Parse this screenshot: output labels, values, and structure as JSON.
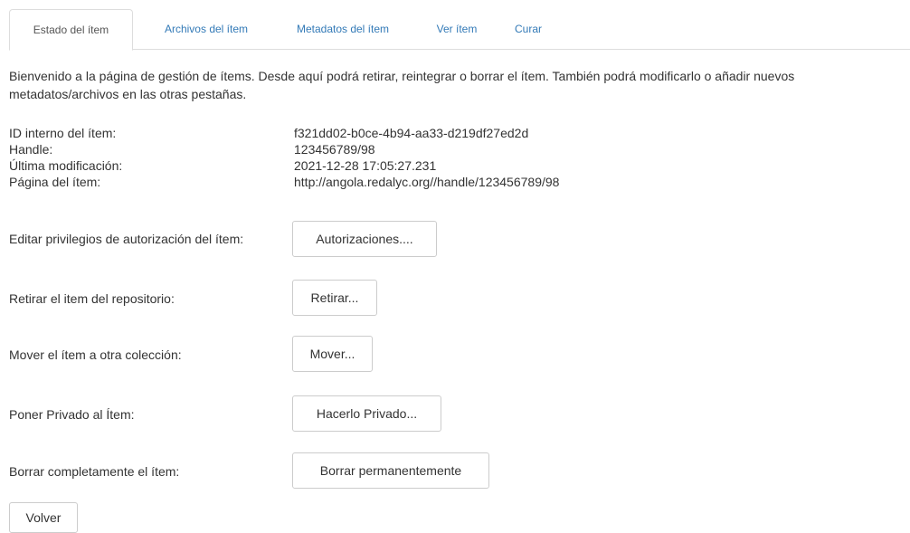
{
  "tabs": [
    {
      "label": "Estado del ítem",
      "active": true
    },
    {
      "label": "Archivos del ítem",
      "active": false
    },
    {
      "label": "Metadatos del ítem",
      "active": false
    },
    {
      "label": "Ver ítem",
      "active": false
    },
    {
      "label": "Curar",
      "active": false
    }
  ],
  "intro": "Bienvenido a la página de gestión de ítems. Desde aquí podrá retirar, reintegrar o borrar el ítem. También podrá modificarlo o añadir nuevos metadatos/archivos en las otras pestañas.",
  "info": {
    "internal_id": {
      "label": "ID interno del ítem:",
      "value": "f321dd02-b0ce-4b94-aa33-d219df27ed2d"
    },
    "handle": {
      "label": "Handle:",
      "value": "123456789/98"
    },
    "last_modified": {
      "label": "Última modificación:",
      "value": "2021-12-28 17:05:27.231"
    },
    "item_page": {
      "label": "Página del ítem:",
      "value": "http://angola.redalyc.org//handle/123456789/98"
    }
  },
  "actions": {
    "authorizations": {
      "label": "Editar privilegios de autorización del ítem:",
      "button": "Autorizaciones...."
    },
    "withdraw": {
      "label": "Retirar el item del repositorio:",
      "button": "Retirar..."
    },
    "move": {
      "label": "Mover el ítem a otra colección:",
      "button": "Mover..."
    },
    "private": {
      "label": "Poner Privado al Ítem:",
      "button": "Hacerlo Privado..."
    },
    "delete": {
      "label": "Borrar completamente el ítem:",
      "button": "Borrar permanentemente"
    }
  },
  "back_button": "Volver",
  "colors": {
    "link": "#337ab7",
    "text": "#333333",
    "border": "#cccccc",
    "tab_border": "#dddddd"
  }
}
